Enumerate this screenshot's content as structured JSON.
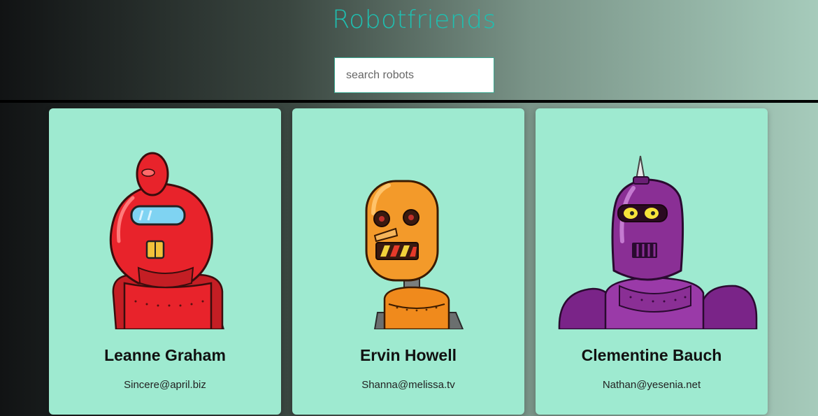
{
  "header": {
    "title": "Robotfriends"
  },
  "search": {
    "placeholder": "search robots",
    "value": ""
  },
  "robots": [
    {
      "name": "Leanne Graham",
      "email": "Sincere@april.biz",
      "color": "#e8232b"
    },
    {
      "name": "Ervin Howell",
      "email": "Shanna@melissa.tv",
      "color": "#f39a2a"
    },
    {
      "name": "Clementine Bauch",
      "email": "Nathan@yesenia.net",
      "color": "#8a2f95"
    }
  ],
  "colors": {
    "card": "#9eead0",
    "title": "#1fbfb0"
  }
}
